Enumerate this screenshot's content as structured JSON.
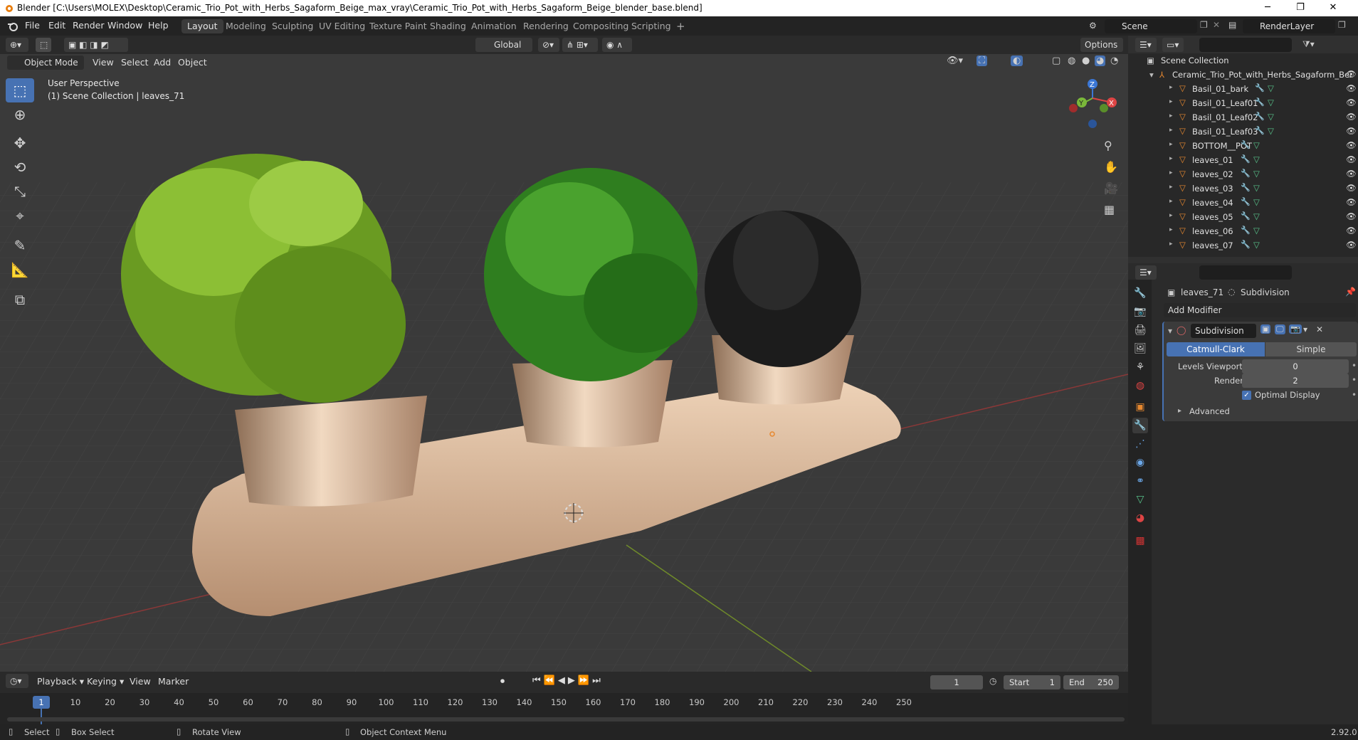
{
  "window": {
    "title": "Blender [C:\\Users\\MOLEX\\Desktop\\Ceramic_Trio_Pot_with_Herbs_Sagaform_Beige_max_vray\\Ceramic_Trio_Pot_with_Herbs_Sagaform_Beige_blender_base.blend]",
    "minimize": "─",
    "restore": "❐",
    "close": "✕"
  },
  "menu": {
    "file": "File",
    "edit": "Edit",
    "render": "Render",
    "window": "Window",
    "help": "Help"
  },
  "workspaces": [
    "Layout",
    "Modeling",
    "Sculpting",
    "UV Editing",
    "Texture Paint",
    "Shading",
    "Animation",
    "Rendering",
    "Compositing",
    "Scripting"
  ],
  "workspace_add": "+",
  "scene": {
    "name": "Scene",
    "render_layer": "RenderLayer"
  },
  "viewport_header": {
    "mode": "Object Mode",
    "view": "View",
    "select": "Select",
    "add": "Add",
    "object": "Object",
    "transform": "Global",
    "options": "Options"
  },
  "viewport": {
    "perspective": "User Perspective",
    "collection_info": "(1) Scene Collection | leaves_71",
    "gizmo_x": "X",
    "gizmo_y": "Y",
    "gizmo_z": "Z"
  },
  "outliner": {
    "root": "Scene Collection",
    "collection": "Ceramic_Trio_Pot_with_Herbs_Sagaform_Bei",
    "items": [
      "Basil_01_bark",
      "Basil_01_Leaf01",
      "Basil_01_Leaf02",
      "Basil_01_Leaf03",
      "BOTTOM__POT",
      "leaves_01",
      "leaves_02",
      "leaves_03",
      "leaves_04",
      "leaves_05",
      "leaves_06",
      "leaves_07"
    ]
  },
  "properties": {
    "object": "leaves_71",
    "modifier_name": "Subdivision",
    "add_modifier": "Add Modifier",
    "mod_name_field": "Subdivision",
    "catmull": "Catmull-Clark",
    "simple": "Simple",
    "levels_viewport_label": "Levels Viewport",
    "levels_viewport": "0",
    "render_label": "Render",
    "render_value": "2",
    "optimal_display": "Optimal Display",
    "optimal_display_checked": true,
    "advanced": "Advanced"
  },
  "timeline": {
    "playback": "Playback",
    "keying": "Keying",
    "view": "View",
    "marker": "Marker",
    "current_frame": "1",
    "start_label": "Start",
    "start": "1",
    "end_label": "End",
    "end": "250",
    "cursor_frame": "1",
    "ticks": [
      "10",
      "20",
      "30",
      "40",
      "50",
      "60",
      "70",
      "80",
      "90",
      "100",
      "110",
      "120",
      "130",
      "140",
      "150",
      "160",
      "170",
      "180",
      "190",
      "200",
      "210",
      "220",
      "230",
      "240",
      "250"
    ]
  },
  "status": {
    "select": "Select",
    "box_select": "Box Select",
    "rotate_view": "Rotate View",
    "context_menu": "Object Context Menu",
    "version": "2.92.0"
  },
  "colors": {
    "accent": "#4772b3",
    "object_orange": "#e7882f",
    "mesh_green": "#57c28a",
    "active_tab": "#4772b3"
  }
}
